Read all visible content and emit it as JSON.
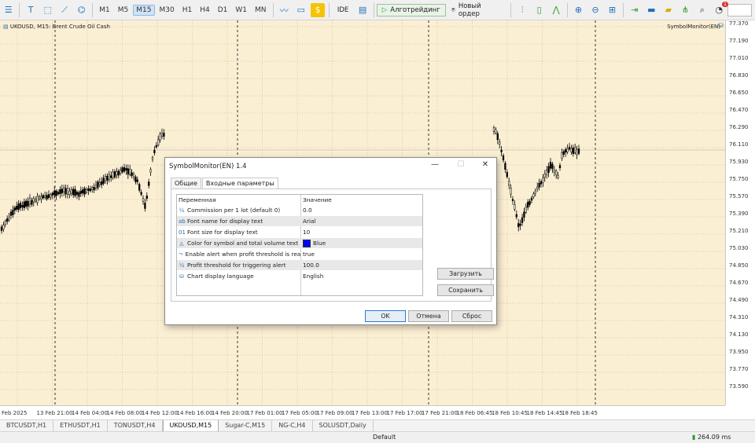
{
  "toolbar": {
    "timeframes": [
      "M1",
      "M5",
      "M15",
      "M30",
      "H1",
      "H4",
      "D1",
      "W1",
      "MN"
    ],
    "active_timeframe": "M15",
    "ide_label": "IDE",
    "algo_label": "Алготрейдинг",
    "new_order_label": "Новый ордер",
    "notification_count": "1"
  },
  "chart": {
    "symbol_label": "UKOUSD, M15:  Brent Crude Oil Cash",
    "indicator_label": "SymbolMonitor(EN)",
    "background": "#fbefd3",
    "candle_color": "#000000",
    "price_levels": [
      "77.370",
      "77.190",
      "77.010",
      "76.830",
      "76.650",
      "76.470",
      "76.290",
      "76.110",
      "75.930",
      "75.750",
      "75.570",
      "75.390",
      "75.210",
      "75.030",
      "74.850",
      "74.670",
      "74.490",
      "74.310",
      "74.130",
      "73.950",
      "73.770",
      "73.590"
    ],
    "time_labels": [
      "Feb 2025",
      "13 Feb 21:00",
      "14 Feb 04:00",
      "14 Feb 08:00",
      "14 Feb 12:00",
      "14 Feb 16:00",
      "14 Feb 20:00",
      "17 Feb 01:00",
      "17 Feb 05:00",
      "17 Feb 09:00",
      "17 Feb 13:00",
      "17 Feb 17:00",
      "17 Feb 21:00",
      "18 Feb 06:45",
      "18 Feb 10:45",
      "18 Feb 14:45",
      "18 Feb 18:45"
    ]
  },
  "dialog": {
    "title": "SymbolMonitor(EN) 1.4",
    "tabs": [
      "Общие",
      "Входные параметры"
    ],
    "active_tab": "Входные параметры",
    "col_variable": "Переменная",
    "col_value": "Значение",
    "params": [
      {
        "icon": "½",
        "name": "Commission per 1 lot (default 0)",
        "value": "0.0"
      },
      {
        "icon": "ab",
        "name": "Font name for display text",
        "value": "Arial"
      },
      {
        "icon": "01",
        "name": "Font size for display text",
        "value": "10"
      },
      {
        "icon": "◬",
        "name": "Color for symbol and total volume text",
        "value": "Blue",
        "swatch": "#0000ff"
      },
      {
        "icon": "⤳",
        "name": "Enable alert when profit threshold is rea...",
        "value": "true"
      },
      {
        "icon": "½",
        "name": "Profit threshold for triggering alert",
        "value": "100.0"
      },
      {
        "icon": "⛁",
        "name": "Chart display language",
        "value": "English"
      }
    ],
    "load_label": "Загрузить",
    "save_label": "Сохранить",
    "ok_label": "OK",
    "cancel_label": "Отмена",
    "reset_label": "Сброс"
  },
  "tabs": [
    "BTCUSDT,H1",
    "ETHUSDT,H1",
    "TONUSDT,H4",
    "UKOUSD,M15",
    "Sugar-C,M15",
    "NG-C,H4",
    "SOLUSDT,Daily"
  ],
  "active_tab": "UKOUSD,M15",
  "status": {
    "profile": "Default",
    "ping": "264.09 ms"
  }
}
